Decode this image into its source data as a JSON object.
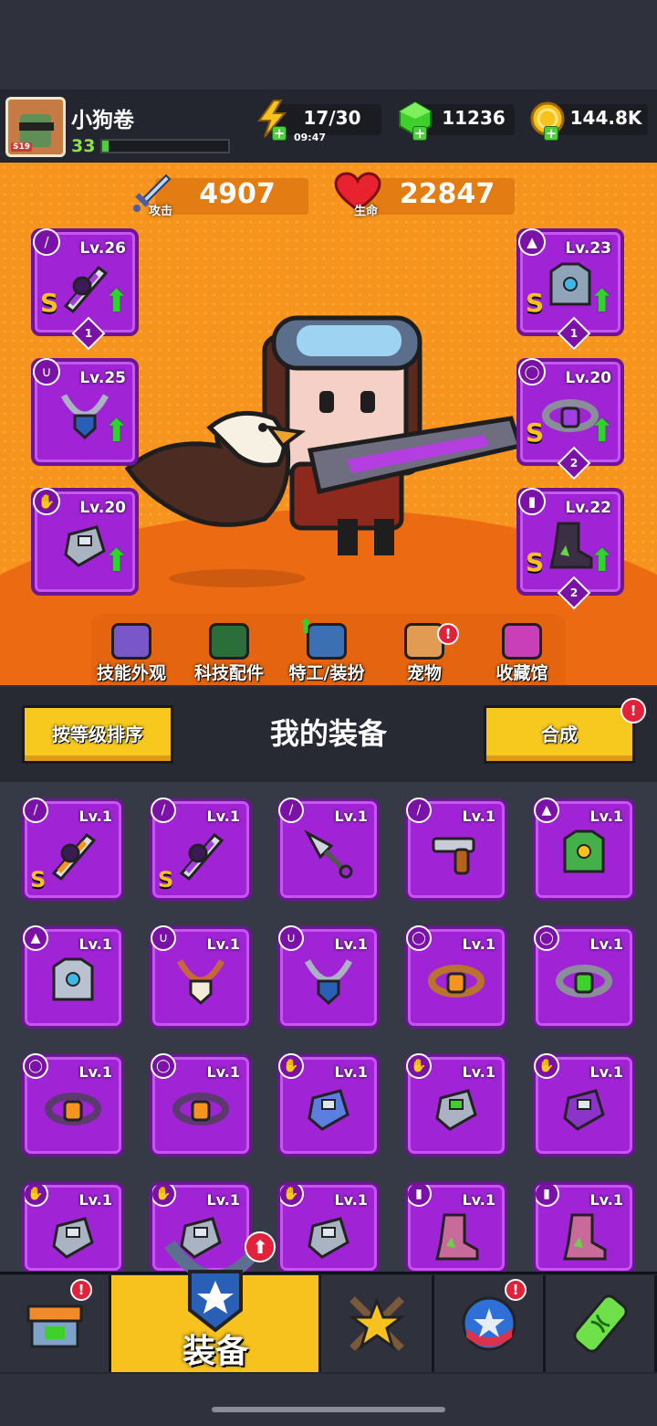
{
  "player": {
    "name": "小狗卷",
    "level": "33",
    "avatar_tag": "S19",
    "xp_fraction": 0.05
  },
  "resources": {
    "energy": {
      "value": "17/30",
      "timer": "09:47",
      "icon": "lightning-icon"
    },
    "gems": {
      "value": "11236",
      "icon": "green-gem-icon"
    },
    "coins": {
      "value": "144.8K",
      "icon": "gold-coin-icon"
    }
  },
  "stats": {
    "attack": {
      "label": "攻击",
      "value": "4907",
      "icon": "sword-icon"
    },
    "health": {
      "label": "生命",
      "value": "22847",
      "icon": "heart-icon"
    }
  },
  "equipped": {
    "left": [
      {
        "level": "Lv.26",
        "type": "weapon",
        "rank": "S",
        "stars": "1",
        "upgrade": true,
        "item": "dark-shuriken-blade"
      },
      {
        "level": "Lv.25",
        "type": "necklace",
        "rank": "",
        "stars": "",
        "upgrade": true,
        "item": "shield-pendant"
      },
      {
        "level": "Lv.20",
        "type": "glove",
        "rank": "",
        "stars": "",
        "upgrade": true,
        "item": "steel-gauntlet"
      }
    ],
    "right": [
      {
        "level": "Lv.23",
        "type": "armor",
        "rank": "S",
        "stars": "1",
        "upgrade": true,
        "item": "mech-armor"
      },
      {
        "level": "Lv.20",
        "type": "belt",
        "rank": "S",
        "stars": "2",
        "upgrade": true,
        "item": "void-belt"
      },
      {
        "level": "Lv.22",
        "type": "boots",
        "rank": "S",
        "stars": "2",
        "upgrade": true,
        "item": "dark-boots"
      }
    ]
  },
  "nav": [
    {
      "label": "技能外观",
      "icon": "skill-skin-icon",
      "badge": false
    },
    {
      "label": "科技配件",
      "icon": "tech-part-icon",
      "badge": false
    },
    {
      "label": "特工/装扮",
      "icon": "agent-costume-icon",
      "badge": false,
      "upgrade": true
    },
    {
      "label": "宠物",
      "icon": "pet-dog-icon",
      "badge": true
    },
    {
      "label": "收藏馆",
      "icon": "collection-chest-icon",
      "badge": false
    }
  ],
  "equipment": {
    "title": "我的装备",
    "sort_label": "按等级排序",
    "merge_label": "合成",
    "merge_badge": "!",
    "items": [
      {
        "level": "Lv.1",
        "type": "weapon",
        "rank": "S",
        "item": "flame-sword"
      },
      {
        "level": "Lv.1",
        "type": "weapon",
        "rank": "S",
        "item": "dark-shuriken-blade"
      },
      {
        "level": "Lv.1",
        "type": "weapon",
        "rank": "",
        "item": "kunai"
      },
      {
        "level": "Lv.1",
        "type": "weapon",
        "rank": "",
        "item": "revolver"
      },
      {
        "level": "Lv.1",
        "type": "armor",
        "rank": "",
        "item": "leaf-armor"
      },
      {
        "level": "Lv.1",
        "type": "armor",
        "rank": "",
        "item": "steel-armor"
      },
      {
        "level": "Lv.1",
        "type": "necklace",
        "rank": "",
        "item": "fang-necklace"
      },
      {
        "level": "Lv.1",
        "type": "necklace",
        "rank": "",
        "item": "shield-pendant"
      },
      {
        "level": "Lv.1",
        "type": "belt",
        "rank": "",
        "item": "rope-belt"
      },
      {
        "level": "Lv.1",
        "type": "belt",
        "rank": "",
        "item": "emerald-belt"
      },
      {
        "level": "Lv.1",
        "type": "belt",
        "rank": "",
        "item": "gold-belt"
      },
      {
        "level": "Lv.1",
        "type": "belt",
        "rank": "",
        "item": "gold-belt"
      },
      {
        "level": "Lv.1",
        "type": "glove",
        "rank": "",
        "item": "fur-claw"
      },
      {
        "level": "Lv.1",
        "type": "glove",
        "rank": "",
        "item": "gem-gauntlet"
      },
      {
        "level": "Lv.1",
        "type": "glove",
        "rank": "",
        "item": "purple-gauntlet"
      },
      {
        "level": "Lv.1",
        "type": "glove",
        "rank": "",
        "item": "steel-gauntlet"
      },
      {
        "level": "Lv.1",
        "type": "glove",
        "rank": "",
        "item": "steel-gauntlet"
      },
      {
        "level": "Lv.1",
        "type": "glove",
        "rank": "",
        "item": "steel-gauntlet"
      },
      {
        "level": "Lv.1",
        "type": "boots",
        "rank": "",
        "item": "spike-boots"
      },
      {
        "level": "Lv.1",
        "type": "boots",
        "rank": "",
        "item": "spike-boots"
      }
    ]
  },
  "tabs": [
    {
      "label": "",
      "icon": "shop-icon",
      "badge": true
    },
    {
      "label": "装备",
      "icon": "equipment-icon",
      "badge": false,
      "upgrade": true,
      "active": true
    },
    {
      "label": "",
      "icon": "battle-star-icon",
      "badge": false
    },
    {
      "label": "",
      "icon": "talent-orb-icon",
      "badge": true
    },
    {
      "label": "",
      "icon": "evolution-capsule-icon",
      "badge": false
    }
  ],
  "colors": {
    "accent": "#f7c21e",
    "slot_purple": "#a024d6",
    "scene_orange": "#f7941d",
    "upgrade_green": "#2fd22f",
    "badge_red": "#e3213a"
  }
}
